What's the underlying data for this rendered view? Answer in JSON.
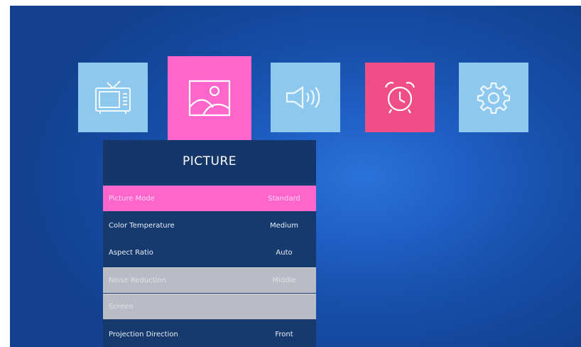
{
  "colors": {
    "tile_tv": "#8ec8ee",
    "tile_picture": "#ff66cc",
    "tile_sound": "#8ec8ee",
    "tile_timer": "#ef4f86",
    "tile_setup": "#8ec8ee",
    "selected_row": "#ff66cc",
    "disabled_row": "#b9bcc4",
    "panel_bg": "#163a6e"
  },
  "tiles": [
    {
      "icon": "tv-icon"
    },
    {
      "icon": "picture-icon"
    },
    {
      "icon": "speaker-icon"
    },
    {
      "icon": "alarm-clock-icon"
    },
    {
      "icon": "gear-icon"
    }
  ],
  "panel": {
    "title": "PICTURE",
    "rows": [
      {
        "label": "Picture Mode",
        "value": "Standard"
      },
      {
        "label": "Color Temperature",
        "value": "Medium"
      },
      {
        "label": "Aspect Ratio",
        "value": "Auto"
      },
      {
        "label": "Noise Reduction",
        "value": "Middle"
      },
      {
        "label": "Screen",
        "value": ""
      },
      {
        "label": "Projection Direction",
        "value": "Front"
      }
    ]
  }
}
